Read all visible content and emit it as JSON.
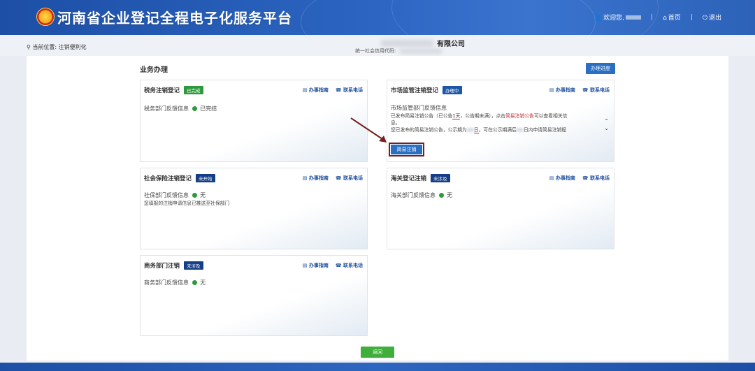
{
  "header": {
    "title": "河南省企业登记全程电子化服务平台",
    "welcome": "欢迎您,",
    "home": "首页",
    "logout": "退出"
  },
  "location": "当前位置: 注销便利化",
  "company": {
    "name": "有限公司",
    "credit_label": "统一社会信用代码:"
  },
  "section_title": "业务办理",
  "progress_button": "办理进度",
  "links": {
    "guide": "办事指南",
    "phone": "联系电话"
  },
  "cards": {
    "tax": {
      "title": "税务注销登记",
      "status": "已完成",
      "feedback_label": "税务部门反馈信息",
      "feedback_value": "已完结"
    },
    "market": {
      "title": "市场监管注销登记",
      "status": "办理中",
      "feedback_label": "市场监管部门反馈信息",
      "line1_a": "已发布简易注销公告（已公告",
      "line1_b": "1天",
      "line1_c": "，公告期未满），点击",
      "line1_d": "简易注销公告",
      "line1_e": "可以查看相关信",
      "line2": "息。",
      "line3_a": "您已发布的简易注销公告，公示期为",
      "line3_b": "日",
      "line3_c": "，可在公示期满后",
      "line3_d": "日内申请简易注销程",
      "button": "简易注销"
    },
    "social": {
      "title": "社会保险注销登记",
      "status": "未开始",
      "feedback_label": "社保部门反馈信息",
      "feedback_value": "无",
      "note": "您填报的注销申请信息已推送至社保部门"
    },
    "customs": {
      "title": "海关登记注销",
      "status": "未涉及",
      "feedback_label": "海关部门反馈信息",
      "feedback_value": "无"
    },
    "commerce": {
      "title": "商务部门注销",
      "status": "未涉及",
      "feedback_label": "商务部门反馈信息",
      "feedback_value": "无"
    }
  },
  "back_button": "返回",
  "colors": {
    "header": "#2a63bf",
    "primary_button": "#2b6fc2",
    "status_done": "#2d9a3e",
    "status_active": "#1e57a8",
    "back_button": "#3fae3a",
    "highlight_red": "#c0252b"
  },
  "icons": {
    "emblem": "national-emblem-icon",
    "user": "user-icon",
    "home": "home-icon",
    "power": "power-icon",
    "location": "location-pin-icon",
    "guide": "book-icon",
    "phone": "phone-icon"
  }
}
